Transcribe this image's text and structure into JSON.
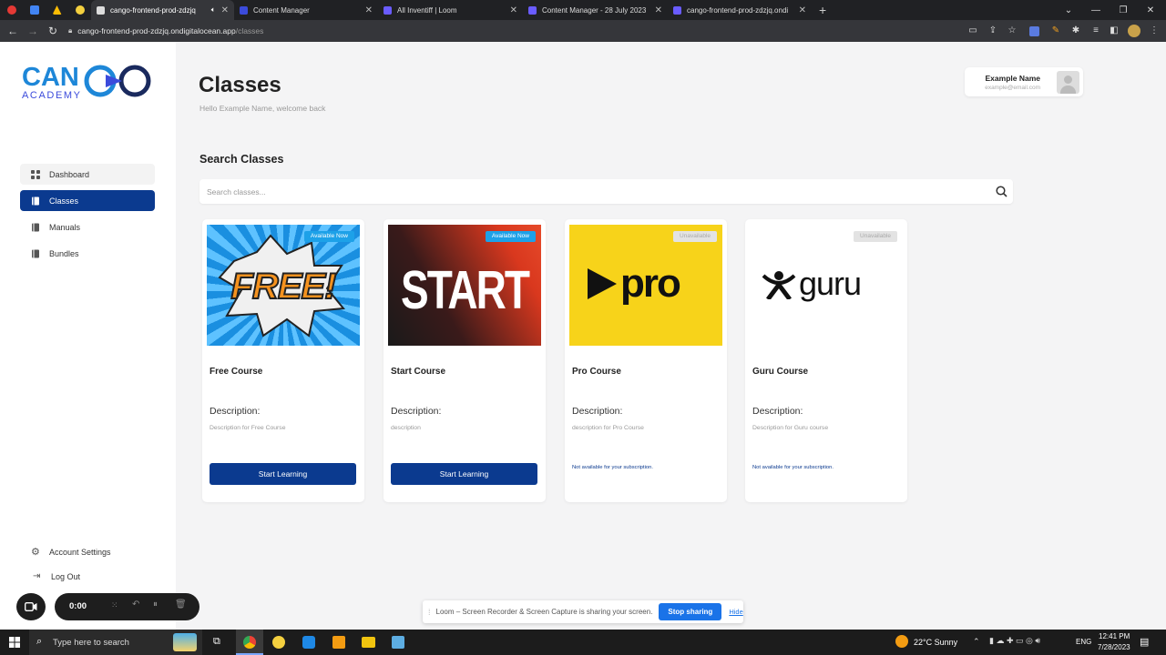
{
  "browser": {
    "tabs": [
      {
        "title": "cango-frontend-prod-zdzjq",
        "fav": "#dddddd",
        "active": true,
        "icons": "speaker-icon"
      },
      {
        "title": "Content Manager",
        "fav": "#3b4bdb"
      },
      {
        "title": "All Inventiff | Loom",
        "fav": "#6a5cff"
      },
      {
        "title": "Content Manager - 28 July 2023",
        "fav": "#6a5cff"
      },
      {
        "title": "cango-frontend-prod-zdzjq.ondi",
        "fav": "#6a5cff"
      }
    ],
    "url_host": "cango-frontend-prod-zdzjq.ondigitalocean.app",
    "url_path": "/classes"
  },
  "logo": {
    "top": "CANGO",
    "bottom": "ACADEMY"
  },
  "sidebar": {
    "items": [
      {
        "label": "Dashboard",
        "icon": "grid-icon"
      },
      {
        "label": "Classes",
        "icon": "book-icon"
      },
      {
        "label": "Manuals",
        "icon": "book-icon"
      },
      {
        "label": "Bundles",
        "icon": "book-icon"
      }
    ],
    "account_settings": "Account Settings",
    "logout": "Log Out"
  },
  "page": {
    "title": "Classes",
    "subtitle": "Hello Example Name, welcome back",
    "search_title": "Search Classes",
    "search_placeholder": "Search classes..."
  },
  "profile": {
    "name": "Example Name",
    "email": "example@email.com"
  },
  "courses": [
    {
      "name": "Free Course",
      "badge": "Available Now",
      "desc_label": "Description:",
      "desc": "Description for Free Course",
      "button": "Start Learning",
      "image_text": "FREE!"
    },
    {
      "name": "Start Course",
      "badge": "Available Now",
      "desc_label": "Description:",
      "desc": "description",
      "button": "Start Learning",
      "image_text": "START"
    },
    {
      "name": "Pro Course",
      "badge": "Unavailable",
      "desc_label": "Description:",
      "desc": "description for Pro Course",
      "note": "Not available for your subscription.",
      "image_text": "pro"
    },
    {
      "name": "Guru Course",
      "badge": "Unavailable",
      "desc_label": "Description:",
      "desc": "Description for Guru course",
      "note": "Not available for your subscription.",
      "image_text": "guru"
    }
  ],
  "loom": {
    "timer": "0:00",
    "notice": "Loom – Screen Recorder & Screen Capture is sharing your screen.",
    "stop": "Stop sharing",
    "hide": "Hide"
  },
  "taskbar": {
    "search_placeholder": "Type here to search",
    "weather": "22°C  Sunny",
    "lang": "ENG",
    "time": "12:41 PM",
    "date": "7/28/2023"
  },
  "colors": {
    "primary": "#0b3a8f",
    "accent": "#1da1e8"
  }
}
